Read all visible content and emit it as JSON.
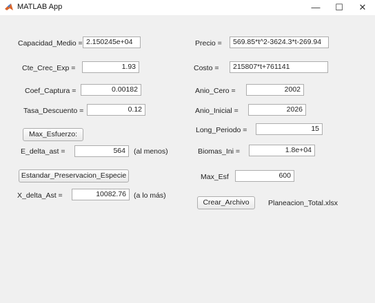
{
  "window": {
    "title": "MATLAB App",
    "controls": {
      "minimize": "—",
      "maximize": "☐",
      "close": "✕"
    }
  },
  "fields": {
    "capacidad_medio": {
      "label": "Capacidad_Medio =",
      "value": "2.150245e+04"
    },
    "cte_crec_exp": {
      "label": "Cte_Crec_Exp =",
      "value": "1.93"
    },
    "coef_captura": {
      "label": "Coef_Captura =",
      "value": "0.00182"
    },
    "tasa_descuento": {
      "label": "Tasa_Descuento =",
      "value": "0.12"
    },
    "e_delta_ast": {
      "label": "E_delta_ast =",
      "value": "564",
      "suffix": "(al menos)"
    },
    "x_delta_ast": {
      "label": "X_delta_Ast =",
      "value": "10082.76",
      "suffix": "(a lo más)"
    },
    "precio": {
      "label": "Precio =",
      "value": "569.85*t^2-3624.3*t-269.94"
    },
    "costo": {
      "label": "Costo =",
      "value": "215807*t+761141"
    },
    "anio_cero": {
      "label": "Anio_Cero =",
      "value": "2002"
    },
    "anio_inicial": {
      "label": "Anio_Inicial =",
      "value": "2026"
    },
    "long_periodo": {
      "label": "Long_Periodo =",
      "value": "15"
    },
    "biomas_ini": {
      "label": "Biomas_Ini =",
      "value": "1.8e+04"
    },
    "max_esf": {
      "label": "Max_Esf",
      "value": "600"
    }
  },
  "buttons": {
    "max_esfuerzo": "Max_Esfuerzo:",
    "estandar_preservacion": "Estandar_Preservacion_Especie",
    "crear_archivo": "Crear_Archivo"
  },
  "output_filename": "Planeacion_Total.xlsx"
}
